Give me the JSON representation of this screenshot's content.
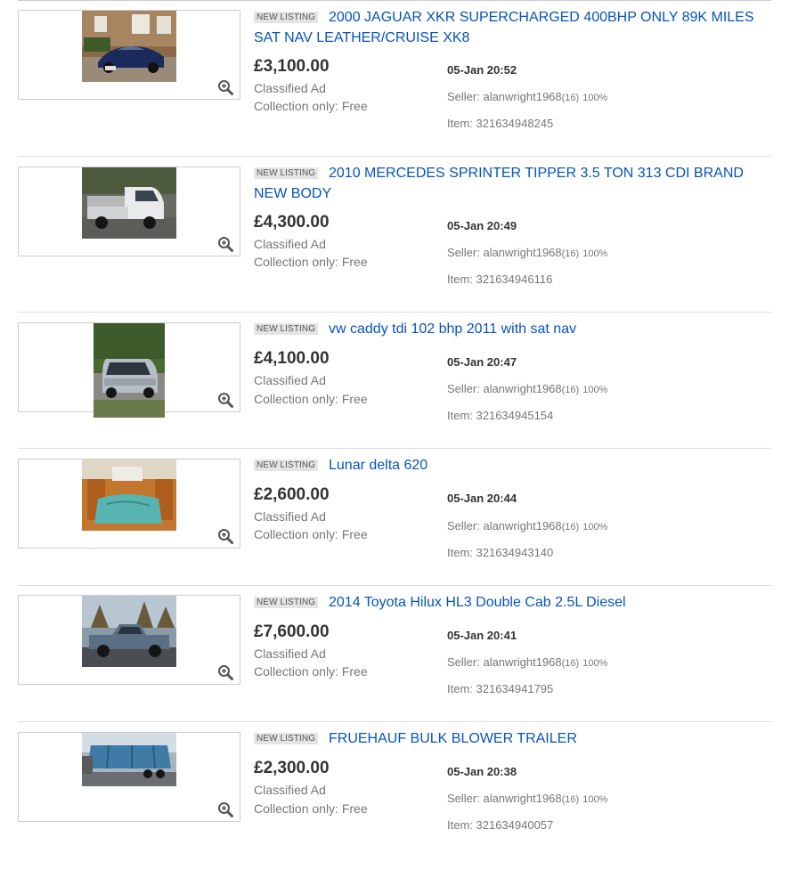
{
  "listings": [
    {
      "badge": "NEW LISTING",
      "title": "2000 JAGUAR XKR SUPERCHARGED 400BHP ONLY 89K MILES SAT NAV LEATHER/CRUISE XK8",
      "price": "£3,100.00",
      "format": "Classified Ad",
      "shipping": "Collection only: Free",
      "time": "05-Jan 20:52",
      "seller_prefix": "Seller: alanwright1968",
      "feedback": "(16)",
      "positive": "100%",
      "item_number": "Item: 321634948245"
    },
    {
      "badge": "NEW LISTING",
      "title": "2010 MERCEDES SPRINTER TIPPER 3.5 TON 313 CDI BRAND NEW BODY",
      "price": "£4,300.00",
      "format": "Classified Ad",
      "shipping": "Collection only: Free",
      "time": "05-Jan 20:49",
      "seller_prefix": "Seller: alanwright1968",
      "feedback": "(16)",
      "positive": "100%",
      "item_number": "Item: 321634946116"
    },
    {
      "badge": "NEW LISTING",
      "title": "vw caddy tdi 102 bhp 2011 with sat nav",
      "price": "£4,100.00",
      "format": "Classified Ad",
      "shipping": "Collection only: Free",
      "time": "05-Jan 20:47",
      "seller_prefix": "Seller: alanwright1968",
      "feedback": "(16)",
      "positive": "100%",
      "item_number": "Item: 321634945154"
    },
    {
      "badge": "NEW LISTING",
      "title": "Lunar delta 620",
      "price": "£2,600.00",
      "format": "Classified Ad",
      "shipping": "Collection only: Free",
      "time": "05-Jan 20:44",
      "seller_prefix": "Seller: alanwright1968",
      "feedback": "(16)",
      "positive": "100%",
      "item_number": "Item: 321634943140"
    },
    {
      "badge": "NEW LISTING",
      "title": "2014 Toyota Hilux HL3 Double Cab 2.5L Diesel",
      "price": "£7,600.00",
      "format": "Classified Ad",
      "shipping": "Collection only: Free",
      "time": "05-Jan 20:41",
      "seller_prefix": "Seller: alanwright1968",
      "feedback": "(16)",
      "positive": "100%",
      "item_number": "Item: 321634941795"
    },
    {
      "badge": "NEW LISTING",
      "title": "FRUEHAUF BULK BLOWER TRAILER",
      "price": "£2,300.00",
      "format": "Classified Ad",
      "shipping": "Collection only: Free",
      "time": "05-Jan 20:38",
      "seller_prefix": "Seller: alanwright1968",
      "feedback": "(16)",
      "positive": "100%",
      "item_number": "Item: 321634940057"
    }
  ],
  "colors": {
    "title_link": "#0654ba",
    "price": "#333333",
    "muted": "#777777",
    "badge_bg": "#e4e4e4"
  },
  "icons": [
    "zoom-in-icon"
  ]
}
